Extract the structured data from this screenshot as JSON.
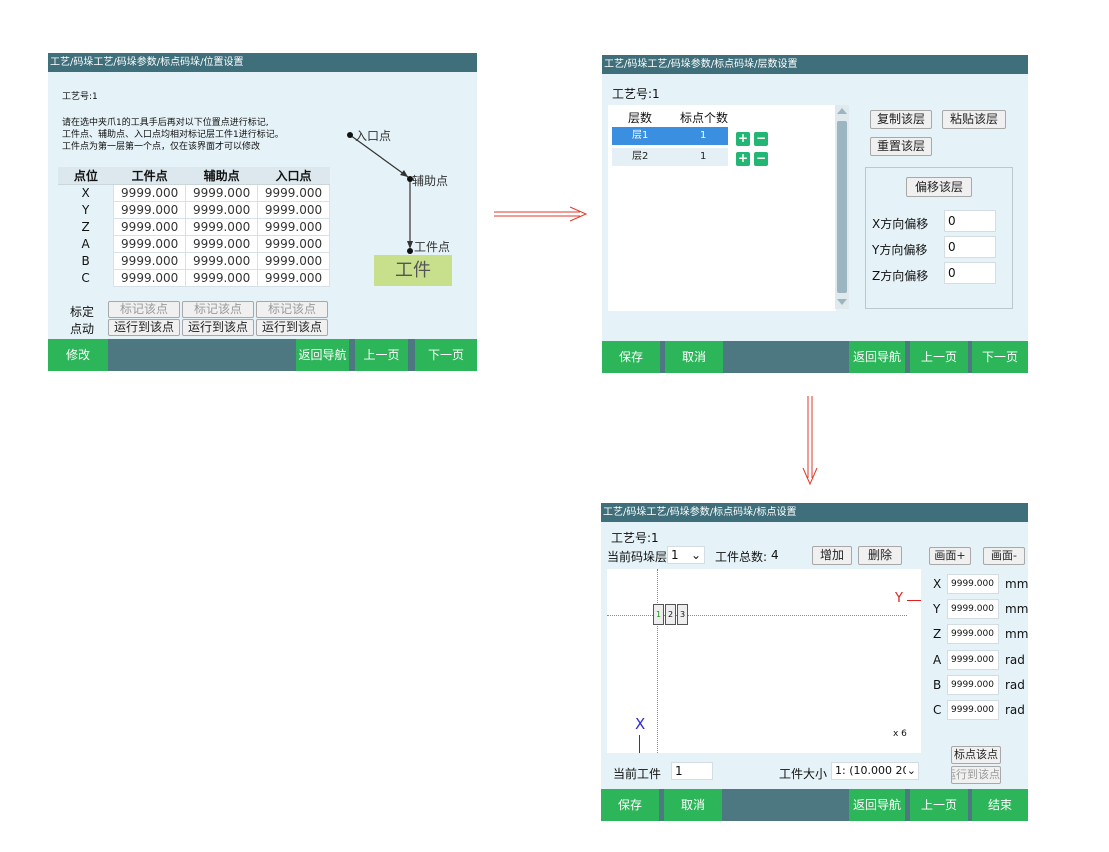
{
  "panel1": {
    "title": "工艺/码垛工艺/码垛参数/标点码垛/位置设置",
    "process_no": "工艺号:1",
    "instructions": [
      "请在选中夹爪1的工具手后再对以下位置点进行标记,",
      "工件点、辅助点、入口点均相对标记层工件1进行标记。",
      "工件点为第一层第一个点，仅在该界面才可以修改"
    ],
    "table": {
      "headers": [
        "点位",
        "工件点",
        "辅助点",
        "入口点"
      ],
      "rows": [
        {
          "axis": "X",
          "v1": "9999.000",
          "v2": "9999.000",
          "v3": "9999.000"
        },
        {
          "axis": "Y",
          "v1": "9999.000",
          "v2": "9999.000",
          "v3": "9999.000"
        },
        {
          "axis": "Z",
          "v1": "9999.000",
          "v2": "9999.000",
          "v3": "9999.000"
        },
        {
          "axis": "A",
          "v1": "9999.000",
          "v2": "9999.000",
          "v3": "9999.000"
        },
        {
          "axis": "B",
          "v1": "9999.000",
          "v2": "9999.000",
          "v3": "9999.000"
        },
        {
          "axis": "C",
          "v1": "9999.000",
          "v2": "9999.000",
          "v3": "9999.000"
        }
      ]
    },
    "calib_label": "标定",
    "jog_label": "点动",
    "mark_button": "标记该点",
    "run_button": "运行到该点",
    "diagram": {
      "entry": "入口点",
      "aux": "辅助点",
      "work_point": "工件点",
      "work_box": "工件"
    },
    "footer": {
      "modify": "修改",
      "back_nav": "返回导航",
      "prev": "上一页",
      "next": "下一页"
    }
  },
  "panel2": {
    "title": "工艺/码垛工艺/码垛参数/标点码垛/层数设置",
    "process_no": "工艺号:1",
    "layer_table": {
      "headers": [
        "层数",
        "标点个数"
      ],
      "rows": [
        {
          "layer": "层1",
          "count": "1"
        },
        {
          "layer": "层2",
          "count": "1"
        }
      ]
    },
    "plus": "+",
    "minus": "−",
    "copy_layer": "复制该层",
    "paste_layer": "粘贴该层",
    "reset_layer": "重置该层",
    "offset_layer": "偏移该层",
    "x_offset_label": "X方向偏移",
    "y_offset_label": "Y方向偏移",
    "z_offset_label": "Z方向偏移",
    "x_offset": "0",
    "y_offset": "0",
    "z_offset": "0",
    "footer": {
      "save": "保存",
      "cancel": "取消",
      "back_nav": "返回导航",
      "prev": "上一页",
      "next": "下一页"
    }
  },
  "panel3": {
    "title": "工艺/码垛工艺/码垛参数/标点码垛/标点设置",
    "process_no": "工艺号:1",
    "current_layer_label": "当前码垛层",
    "current_layer": "1",
    "total_label": "工件总数:",
    "total": "4",
    "add": "增加",
    "delete": "删除",
    "zoom_in": "画面+",
    "zoom_out": "画面-",
    "canvas": {
      "y_axis": "Y",
      "x_axis": "X",
      "scale": "x 6",
      "pieces": [
        "1",
        "2",
        "3"
      ]
    },
    "coords": [
      {
        "axis": "X",
        "value": "9999.000",
        "unit": "mm"
      },
      {
        "axis": "Y",
        "value": "9999.000",
        "unit": "mm"
      },
      {
        "axis": "Z",
        "value": "9999.000",
        "unit": "mm"
      },
      {
        "axis": "A",
        "value": "9999.000",
        "unit": "rad"
      },
      {
        "axis": "B",
        "value": "9999.000",
        "unit": "rad"
      },
      {
        "axis": "C",
        "value": "9999.000",
        "unit": "rad"
      }
    ],
    "mark_point": "标点该点",
    "run_point": "运行到该点",
    "current_piece_label": "当前工件",
    "current_piece": "1",
    "piece_size_label": "工件大小",
    "piece_size": "1: (10.000 20",
    "footer": {
      "save": "保存",
      "cancel": "取消",
      "back_nav": "返回导航",
      "prev": "上一页",
      "finish": "结束"
    }
  },
  "colors": {
    "title_bar": "#3f6f7b",
    "panel_bg": "#e5f2f8",
    "green_button": "#2db559",
    "arrow": "#e03a2a",
    "axis_red": "#e02020",
    "axis_blue": "#2a2ae0"
  }
}
